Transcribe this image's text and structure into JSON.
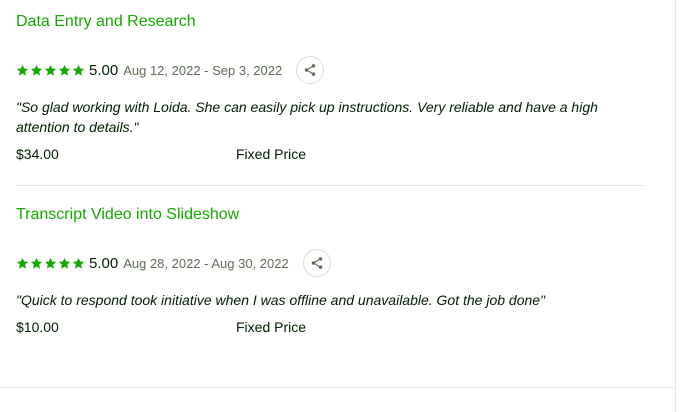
{
  "jobs": [
    {
      "title": "Data Entry and Research",
      "rating": 5,
      "score": "5.00",
      "dates": "Aug 12, 2022 - Sep 3, 2022",
      "quote": "\"So glad working with Loida. She can easily pick up instructions. Very reliable and have a high attention to details.\"",
      "price": "$34.00",
      "price_type": "Fixed Price"
    },
    {
      "title": "Transcript Video into Slideshow",
      "rating": 5,
      "score": "5.00",
      "dates": "Aug 28, 2022 - Aug 30, 2022",
      "quote": "\"Quick to respond took initiative when I was offline and unavailable. Got the job done\"",
      "price": "$10.00",
      "price_type": "Fixed Price"
    }
  ],
  "colors": {
    "accent": "#14a800",
    "text": "#001e00",
    "muted": "#5e6d55",
    "border": "#e4ebe4"
  },
  "icons": {
    "star": "star-icon",
    "share": "share-icon"
  }
}
